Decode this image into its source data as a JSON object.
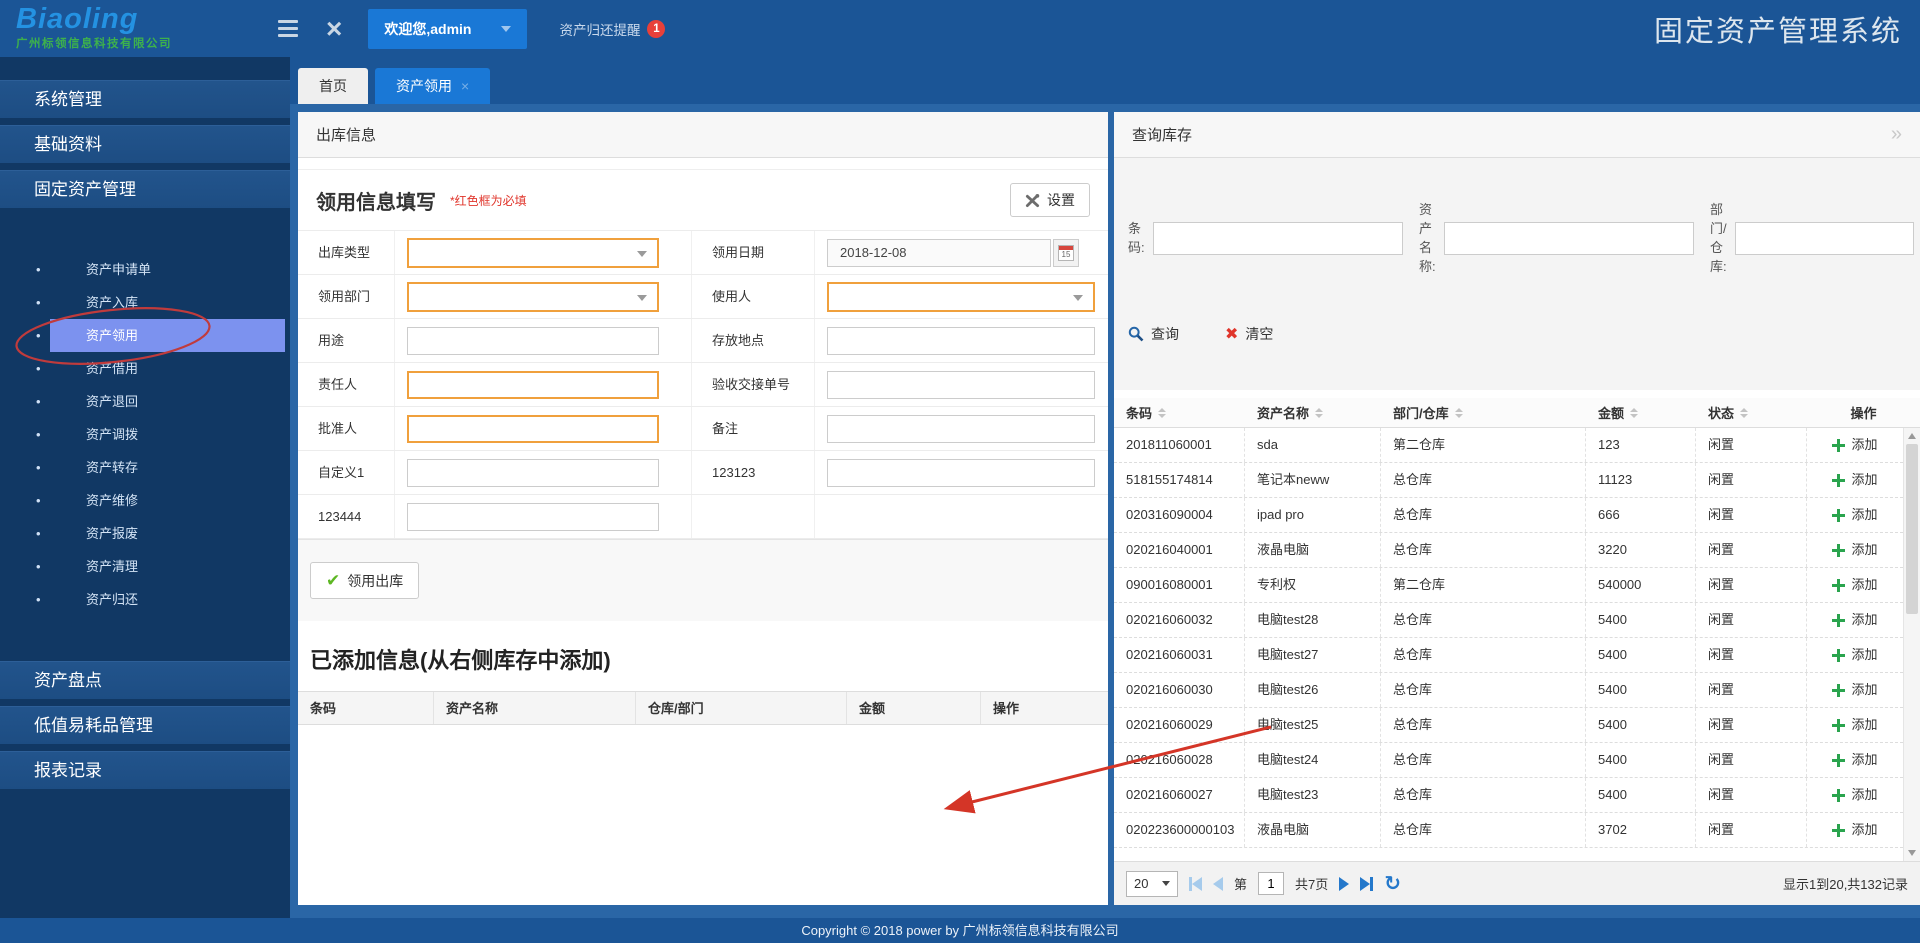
{
  "app": {
    "title": "固定资产管理系统",
    "footer": "Copyright © 2018 power by 广州标领信息科技有限公司"
  },
  "header": {
    "logo_text": "Biaoling",
    "logo_sub": "广州标领信息科技有限公司",
    "welcome": "欢迎您,admin",
    "reminder": "资产归还提醒",
    "reminder_count": "1"
  },
  "tabs": [
    {
      "label": "首页",
      "active": false
    },
    {
      "label": "资产领用",
      "active": true
    }
  ],
  "sidebar": {
    "sections": [
      {
        "label": "系统管理"
      },
      {
        "label": "基础资料"
      },
      {
        "label": "固定资产管理",
        "items": [
          "资产申请单",
          "资产入库",
          "资产领用",
          "资产借用",
          "资产退回",
          "资产调拨",
          "资产转存",
          "资产维修",
          "资产报废",
          "资产清理",
          "资产归还"
        ],
        "active_item": "资产领用"
      },
      {
        "label": "资产盘点"
      },
      {
        "label": "低值易耗品管理"
      },
      {
        "label": "报表记录"
      }
    ]
  },
  "outbound_panel": {
    "title": "出库信息",
    "form_title": "领用信息填写",
    "required_note": "*红色框为必填",
    "settings_label": "设置",
    "form_rows": [
      [
        {
          "label": "出库类型",
          "type": "select",
          "required": true
        },
        {
          "label": "领用日期",
          "type": "date",
          "value": "2018-12-08"
        }
      ],
      [
        {
          "label": "领用部门",
          "type": "select",
          "required": true
        },
        {
          "label": "使用人",
          "type": "select",
          "required": true
        }
      ],
      [
        {
          "label": "用途",
          "type": "text"
        },
        {
          "label": "存放地点",
          "type": "text"
        }
      ],
      [
        {
          "label": "责任人",
          "type": "text",
          "required": true
        },
        {
          "label": "验收交接单号",
          "type": "text"
        }
      ],
      [
        {
          "label": "批准人",
          "type": "text",
          "required": true
        },
        {
          "label": "备注",
          "type": "text"
        }
      ],
      [
        {
          "label": "自定义1",
          "type": "text"
        },
        {
          "label": "123123",
          "type": "text"
        }
      ],
      [
        {
          "label": "123444",
          "type": "text"
        },
        null
      ]
    ],
    "submit_label": "领用出库",
    "added_title": "已添加信息(从右侧库存中添加)",
    "added_columns": [
      "条码",
      "资产名称",
      "仓库/部门",
      "金额",
      "操作"
    ]
  },
  "inventory_panel": {
    "title": "查询库存",
    "filters": [
      {
        "label": "条码:"
      },
      {
        "label": "资产名称:"
      },
      {
        "label": "部门/仓库:"
      }
    ],
    "search_label": "查询",
    "clear_label": "清空",
    "columns": [
      "条码",
      "资产名称",
      "部门/仓库",
      "金额",
      "状态",
      "操作"
    ],
    "sortable": [
      true,
      true,
      true,
      true,
      true,
      false
    ],
    "add_label": "添加",
    "rows": [
      [
        "201811060001",
        "sda",
        "第二仓库",
        "123",
        "闲置"
      ],
      [
        "518155174814",
        "笔记本neww",
        "总仓库",
        "11123",
        "闲置"
      ],
      [
        "020316090004",
        "ipad pro",
        "总仓库",
        "666",
        "闲置"
      ],
      [
        "020216040001",
        "液晶电脑",
        "总仓库",
        "3220",
        "闲置"
      ],
      [
        "090016080001",
        "专利权",
        "第二仓库",
        "540000",
        "闲置"
      ],
      [
        "020216060032",
        "电脑test28",
        "总仓库",
        "5400",
        "闲置"
      ],
      [
        "020216060031",
        "电脑test27",
        "总仓库",
        "5400",
        "闲置"
      ],
      [
        "020216060030",
        "电脑test26",
        "总仓库",
        "5400",
        "闲置"
      ],
      [
        "020216060029",
        "电脑test25",
        "总仓库",
        "5400",
        "闲置"
      ],
      [
        "020216060028",
        "电脑test24",
        "总仓库",
        "5400",
        "闲置"
      ],
      [
        "020216060027",
        "电脑test23",
        "总仓库",
        "5400",
        "闲置"
      ],
      [
        "020223600000103",
        "液晶电脑",
        "总仓库",
        "3702",
        "闲置"
      ]
    ],
    "pagination": {
      "page_size": "20",
      "prefix": "第",
      "page": "1",
      "suffix": "共7页",
      "info": "显示1到20,共132记录"
    }
  },
  "palette": {
    "accent_blue": "#1a78d6",
    "header_blue": "#1b5596",
    "sidebar_navy": "#113864",
    "section_blue": "#1d4d83",
    "highlight_blue": "#7c92ef",
    "content_blue": "#2a66a6",
    "required_orange": "#f0a03c",
    "success_green": "#2aa44e",
    "check_green": "#5db723",
    "danger_red": "#e0352b",
    "badge_red": "#e8403a",
    "pager_blue": "#2478cb",
    "pager_pale": "#a6cbec",
    "annotation_red": "#d43527"
  }
}
